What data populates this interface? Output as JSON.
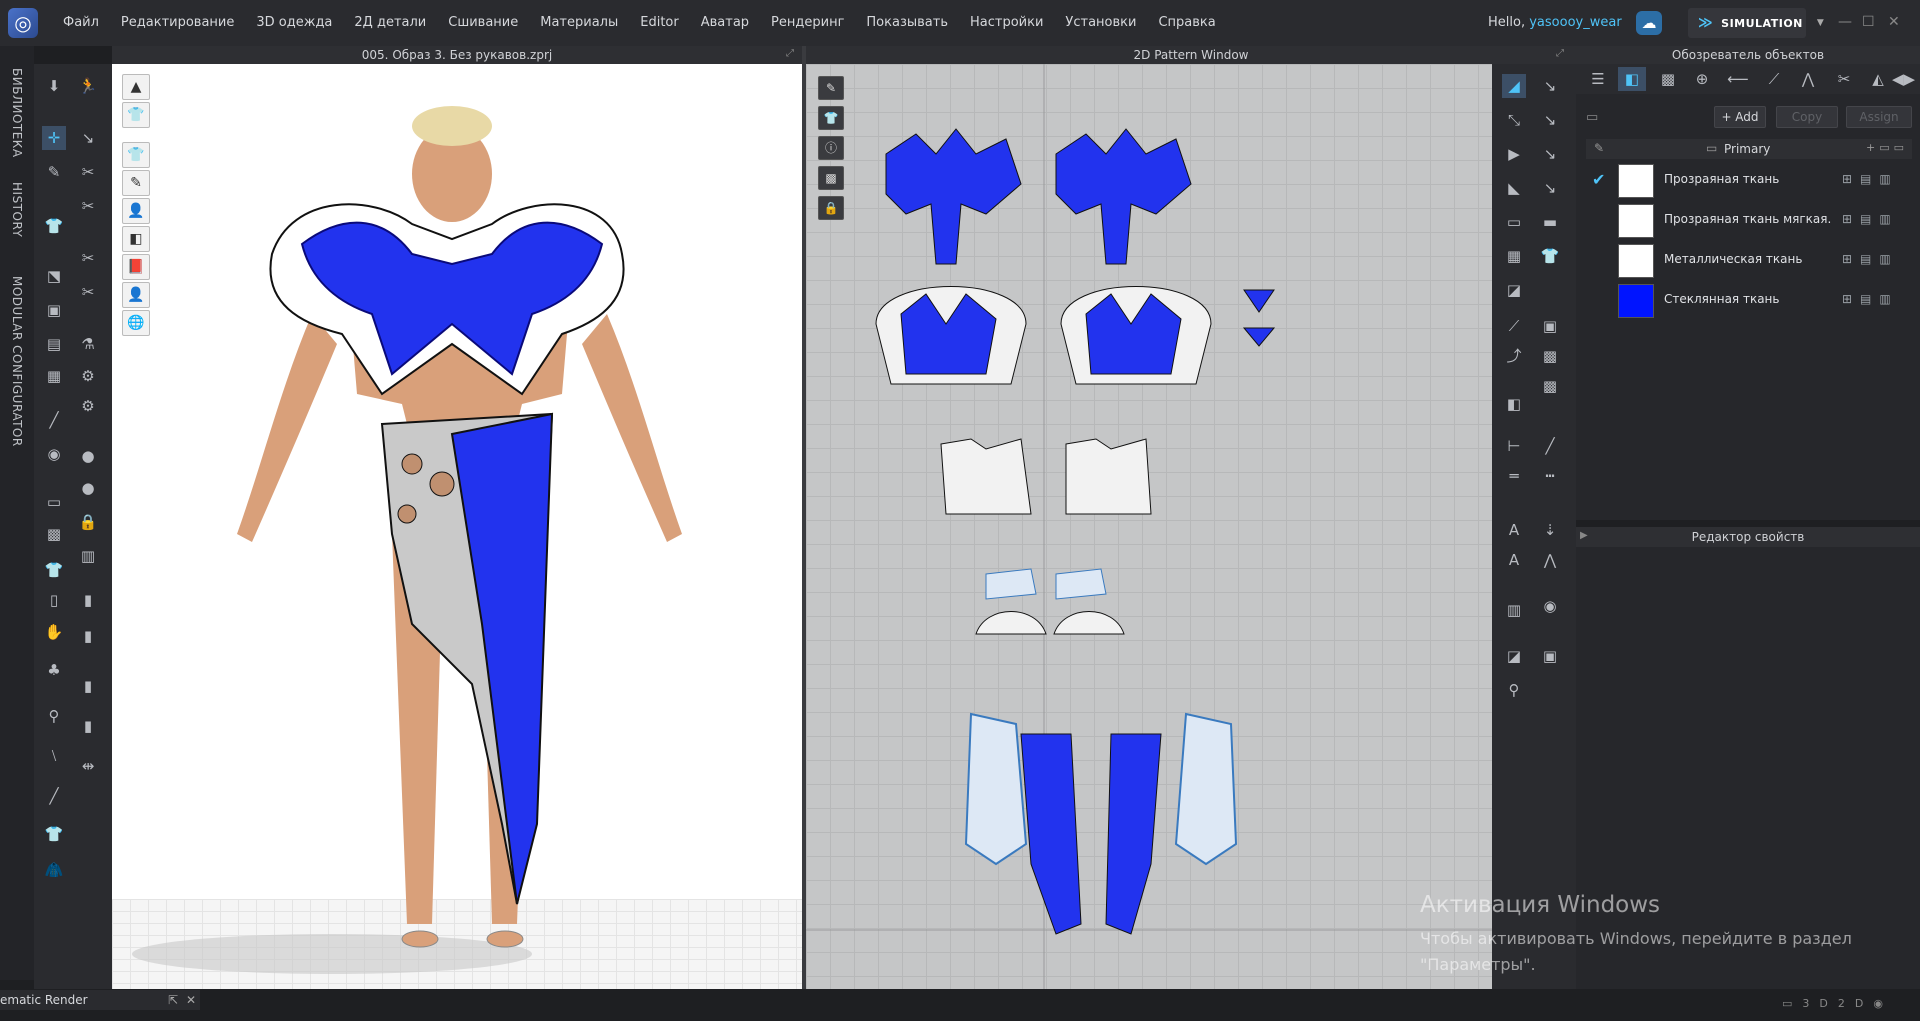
{
  "app": {
    "menu": [
      "Файл",
      "Редактирование",
      "3D одежда",
      "2Д детали",
      "Сшивание",
      "Материалы",
      "Editor",
      "Аватар",
      "Рендеринг",
      "Показывать",
      "Настройки",
      "Установки",
      "Справка"
    ],
    "greeting": "Hello,",
    "username": "yasoooy_wear",
    "mode_label": "SIMULATION"
  },
  "side_tabs": [
    "БИБЛИОТЕКА",
    "HISTORY",
    "MODULAR CONFIGURATOR"
  ],
  "window_3d": {
    "title": "005. Образ 3. Без рукавов.zprj"
  },
  "window_2d": {
    "title": "2D Pattern Window"
  },
  "object_browser": {
    "title": "Обозреватель объектов",
    "add_label": "+ Add",
    "copy_label": "Copy",
    "assign_label": "Assign",
    "primary_label": "Primary",
    "fabrics": [
      {
        "name": "Прозраяная ткань",
        "color": "#ffffff",
        "checked": true
      },
      {
        "name": "Прозраяная ткань мягкая. Р",
        "color": "#ffffff",
        "checked": false
      },
      {
        "name": "Металлическая ткань",
        "color": "#ffffff",
        "checked": false
      },
      {
        "name": "Стеклянная ткань",
        "color": "#0014ff",
        "checked": false
      }
    ]
  },
  "property_editor": {
    "title": "Редактор свойств"
  },
  "watermark": {
    "heading": "Активация Windows",
    "line1": "Чтобы активировать Windows, перейдите в раздел",
    "line2": "\"Параметры\"."
  },
  "bottom": {
    "cinematic_label": "ematic Render"
  },
  "colors": {
    "accent": "#4fc3f7",
    "garment_blue": "#2233ee"
  }
}
